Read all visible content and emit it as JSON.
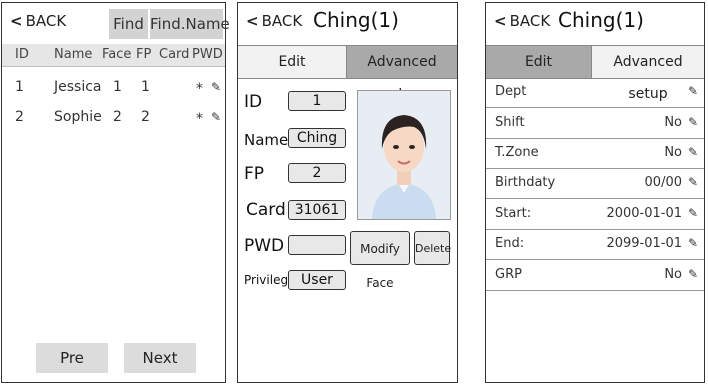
{
  "panel1": {
    "back": "BACK",
    "find": "Find",
    "find_name": "Find.Name",
    "columns": [
      "ID",
      "Name",
      "Face",
      "FP",
      "Card",
      "PWD"
    ],
    "rows": [
      {
        "id": "1",
        "name": "Jessica",
        "face": "1",
        "fp": "1",
        "pwd": "*"
      },
      {
        "id": "2",
        "name": "Sophie",
        "face": "2",
        "fp": "2",
        "pwd": "*"
      }
    ],
    "prev": "Pre",
    "next": "Next"
  },
  "panel2": {
    "back": "BACK",
    "title": "Ching(1)",
    "tab_edit": "Edit",
    "tab_advanced": "Advanced setup",
    "id_label": "ID",
    "id_value": "1",
    "name_label": "Name",
    "name_value": "Ching",
    "fp_label": "FP",
    "fp_value": "2",
    "card_label": "Card",
    "card_value": "31061",
    "pwd_label": "PWD",
    "pwd_value": "",
    "privilege_label": "Privilege",
    "privilege_value": "User",
    "modify_face": "Modify Face",
    "delete": "Delete"
  },
  "panel3": {
    "back": "BACK",
    "title": "Ching(1)",
    "tab_edit": "Edit",
    "tab_advanced": "Advanced setup",
    "rows": [
      {
        "label": "Dept",
        "value": ""
      },
      {
        "label": "Shift",
        "value": "No"
      },
      {
        "label": "T.Zone",
        "value": "No"
      },
      {
        "label": "Birthdaty",
        "value": "00/00"
      },
      {
        "label": "Start:",
        "value": "2000-01-01"
      },
      {
        "label": "End:",
        "value": "2099-01-01"
      },
      {
        "label": "GRP",
        "value": "No"
      }
    ]
  },
  "icons": {
    "back": "chevron-left-icon",
    "edit": "pencil-icon"
  }
}
